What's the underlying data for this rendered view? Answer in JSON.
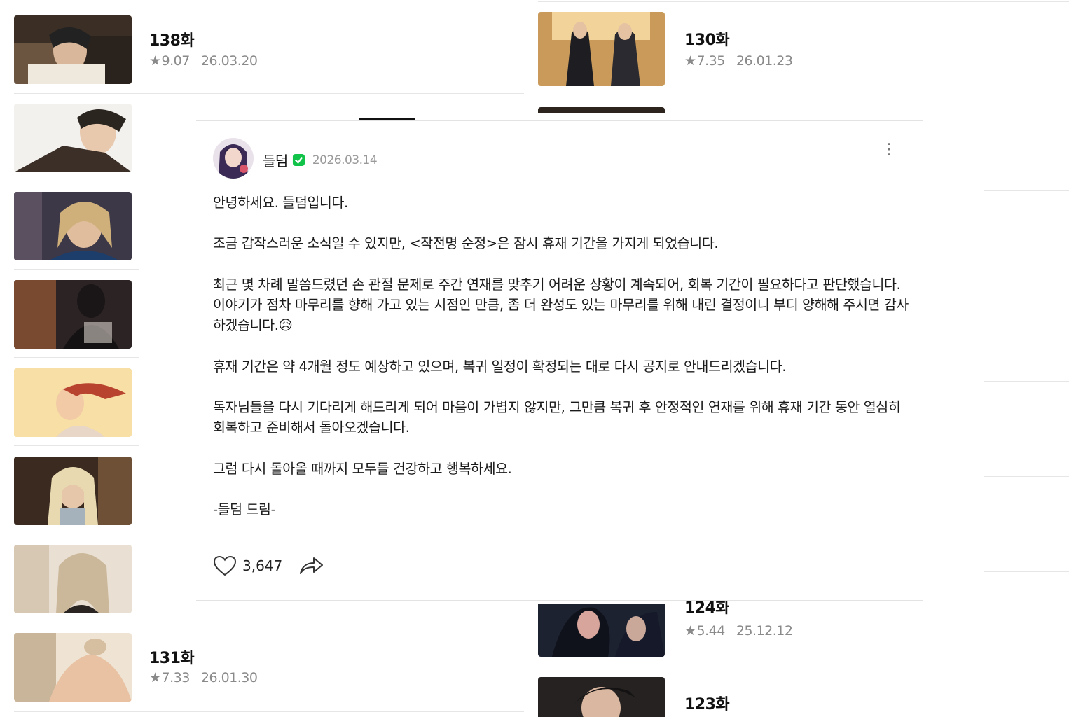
{
  "episodes": {
    "left_top": {
      "title": "138화",
      "rating": "9.07",
      "date": "26.03.20"
    },
    "right_top": {
      "title": "130화",
      "rating": "7.35",
      "date": "26.01.23"
    },
    "left_bottom": {
      "title": "131화",
      "rating": "7.33",
      "date": "26.01.30"
    },
    "right_mid": {
      "title": "124화",
      "rating": "5.44",
      "date": "25.12.12"
    },
    "right_bottom": {
      "title": "123화"
    }
  },
  "post": {
    "author": "들덤",
    "date": "2026.03.14",
    "more_icon": "⋮",
    "paragraphs": [
      "안녕하세요. 들덤입니다.",
      "",
      "조금 갑작스러운 소식일 수 있지만, <작전명 순정>은 잠시 휴재 기간을 가지게 되었습니다.",
      "",
      "최근 몇 차례 말씀드렸던 손 관절 문제로 주간 연재를 맞추기 어려운 상황이 계속되어, 회복 기간이 필요하다고 판단했습니다.",
      "이야기가 점차 마무리를 향해 가고 있는 시점인 만큼, 좀 더 완성도 있는 마무리를 위해 내린 결정이니 부디 양해해 주시면 감사하겠습니다.😥",
      "",
      "휴재 기간은 약 4개월 정도 예상하고 있으며, 복귀 일정이 확정되는 대로 다시 공지로 안내드리겠습니다.",
      "",
      "독자님들을 다시 기다리게 해드리게 되어 마음이 가볍지 않지만, 그만큼 복귀 후 안정적인 연재를 위해 휴재 기간 동안 열심히 회복하고 준비해서 돌아오겠습니다.",
      "",
      "그럼 다시 돌아올 때까지 모두들 건강하고 행복하세요.",
      "",
      "-들덤 드림-"
    ],
    "likes": "3,647",
    "icons": {
      "like": "heart-icon",
      "share": "share-icon",
      "verified": "verified-badge-icon"
    }
  },
  "colors": {
    "meta": "#8a8a8a",
    "verified": "#12c34a",
    "divider": "#e6e6e6"
  }
}
